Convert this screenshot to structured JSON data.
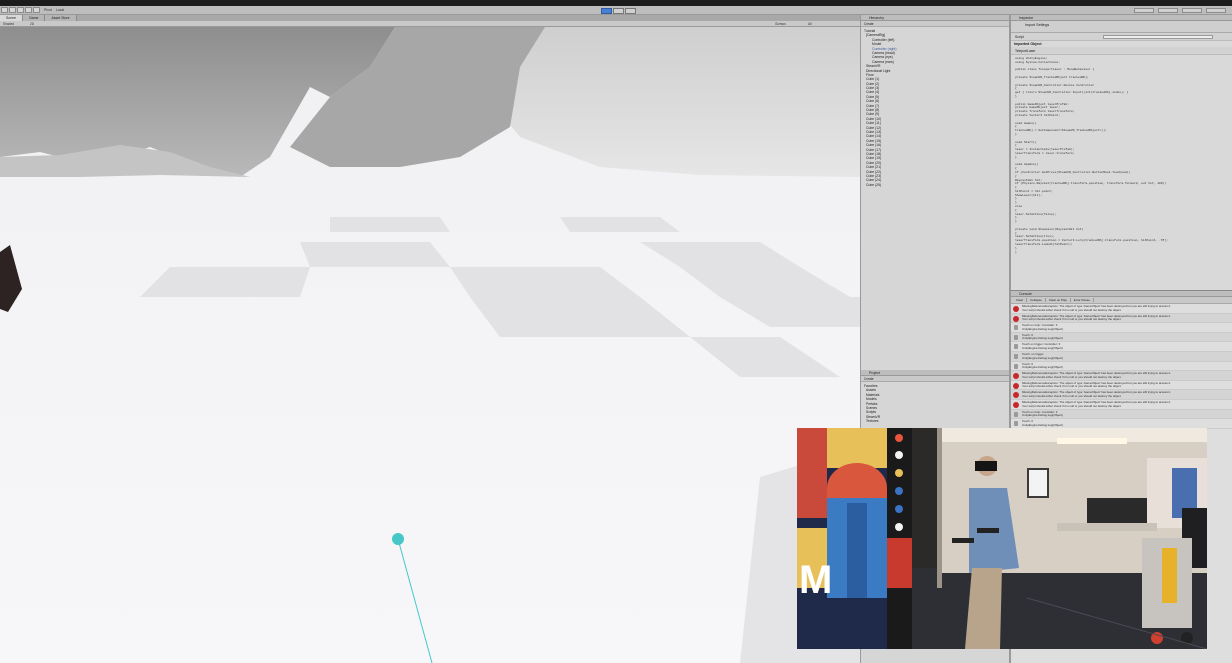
{
  "toolbar": {
    "labels": [
      "Pivot",
      "Local"
    ],
    "play": "play-icon",
    "pause": "pause-icon",
    "step": "step-icon"
  },
  "tabs": [
    "Scene",
    "Game",
    "Asset Store"
  ],
  "scene_sub": {
    "shading": "Shaded",
    "mode": "2D",
    "gizmos": "Gizmos",
    "search": "All"
  },
  "hierarchy": {
    "title": "Hierarchy",
    "create": "Create",
    "items": [
      "Tutorial",
      "[CameraRig]",
      "Controller (left)",
      "Model",
      "Controller (right)",
      "Camera (head)",
      "Camera (eye)",
      "Camera (ears)",
      "SteamVR",
      "Directional Light",
      "Floor",
      "Cube (1)",
      "Cube (2)",
      "Cube (3)",
      "Cube (4)",
      "Cube (5)",
      "Cube (6)",
      "Cube (7)",
      "Cube (8)",
      "Cube (9)",
      "Cube (10)",
      "Cube (11)",
      "Cube (12)",
      "Cube (13)",
      "Cube (14)",
      "Cube (15)",
      "Cube (16)",
      "Cube (17)",
      "Cube (18)",
      "Cube (19)",
      "Cube (20)",
      "Cube (21)",
      "Cube (22)",
      "Cube (23)",
      "Cube (24)",
      "Cube (25)"
    ]
  },
  "project": {
    "title": "Project",
    "create": "Create",
    "items": [
      "Favorites",
      "Assets",
      "Materials",
      "Models",
      "Prefabs",
      "Scenes",
      "Scripts",
      "SteamVR",
      "Textures"
    ]
  },
  "inspector": {
    "title": "Inspector",
    "asset_name": "TeleportLaser",
    "import_label": "Import Settings",
    "script_label": "Script",
    "script_value": "TeleportLaser",
    "section": "Imported Object",
    "code": [
      "using UnityEngine;",
      "using System.Collections;",
      "",
      "public class TeleportLaser : MonoBehaviour {",
      "",
      "  private SteamVR_TrackedObject trackedObj;",
      "",
      "  private SteamVR_Controller.Device Controller",
      "  {",
      "    get { return SteamVR_Controller.Input((int)trackedObj.index); }",
      "  }",
      "",
      "  public GameObject laserPrefab;",
      "  private GameObject laser;",
      "  private Transform laserTransform;",
      "  private Vector3 hitPoint;",
      "",
      "  void Awake()",
      "  {",
      "    trackedObj = GetComponent<SteamVR_TrackedObject>();",
      "  }",
      "",
      "  void Start()",
      "  {",
      "    laser = Instantiate(laserPrefab);",
      "    laserTransform = laser.transform;",
      "  }",
      "",
      "  void Update()",
      "  {",
      "    if (Controller.GetPress(SteamVR_Controller.ButtonMask.Touchpad))",
      "    {",
      "      RaycastHit hit;",
      "      if (Physics.Raycast(trackedObj.transform.position, transform.forward, out hit, 100))",
      "      {",
      "        hitPoint = hit.point;",
      "        ShowLaser(hit);",
      "      }",
      "    }",
      "    else",
      "    {",
      "      laser.SetActive(false);",
      "    }",
      "  }",
      "",
      "  private void ShowLaser(RaycastHit hit)",
      "  {",
      "    laser.SetActive(true);",
      "    laserTransform.position = Vector3.Lerp(trackedObj.transform.position, hitPoint, .5f);",
      "    laserTransform.LookAt(hitPoint);",
      "  }",
      "}"
    ]
  },
  "console": {
    "title": "Console",
    "buttons": [
      "Clear",
      "Collapse",
      "Clear on Play",
      "Error Pause"
    ],
    "logs": [
      {
        "type": "err",
        "line1": "MissingReferenceException: The object of type 'GameObject' has been destroyed but you are still trying to access it.",
        "line2": "Your script should either check if it is null or you should not destroy the object."
      },
      {
        "type": "err",
        "line1": "MissingReferenceException: The object of type 'GameObject' has been destroyed but you are still trying to access it.",
        "line2": "Your script should either check if it is null or you should not destroy the object."
      },
      {
        "type": "info",
        "line1": "Touch on Grip: Controller: 3",
        "line2": "UnityEngine.Debug:Log(Object)"
      },
      {
        "type": "info",
        "line1": "Touch: 0",
        "line2": "UnityEngine.Debug:Log(Object)"
      },
      {
        "type": "info",
        "line1": "Touch on trigger: Controller: 3",
        "line2": "UnityEngine.Debug:Log(Object)"
      },
      {
        "type": "info",
        "line1": "Touch: on trigger",
        "line2": "UnityEngine.Debug:Log(Object)"
      },
      {
        "type": "info",
        "line1": "Touch: 0",
        "line2": "UnityEngine.Debug:Log(Object)"
      },
      {
        "type": "err",
        "line1": "MissingReferenceException: The object of type 'GameObject' has been destroyed but you are still trying to access it.",
        "line2": "Your script should either check if it is null or you should not destroy the object."
      },
      {
        "type": "err",
        "line1": "MissingReferenceException: The object of type 'GameObject' has been destroyed but you are still trying to access it.",
        "line2": "Your script should either check if it is null or you should not destroy the object."
      },
      {
        "type": "err",
        "line1": "MissingReferenceException: The object of type 'GameObject' has been destroyed but you are still trying to access it.",
        "line2": "Your script should either check if it is null or you should not destroy the object."
      },
      {
        "type": "err",
        "line1": "MissingReferenceException: The object of type 'GameObject' has been destroyed but you are still trying to access it.",
        "line2": "Your script should either check if it is null or you should not destroy the object."
      },
      {
        "type": "info",
        "line1": "Touch on Grip: Controller: 3",
        "line2": "UnityEngine.Debug:Log(Object)"
      },
      {
        "type": "info",
        "line1": "Touch: 0",
        "line2": "UnityEngine.Debug:Log(Object)"
      }
    ]
  },
  "colors": {
    "laser": "#46c8c8",
    "error": "#c6282b",
    "play_active": "#4a7fd6"
  }
}
